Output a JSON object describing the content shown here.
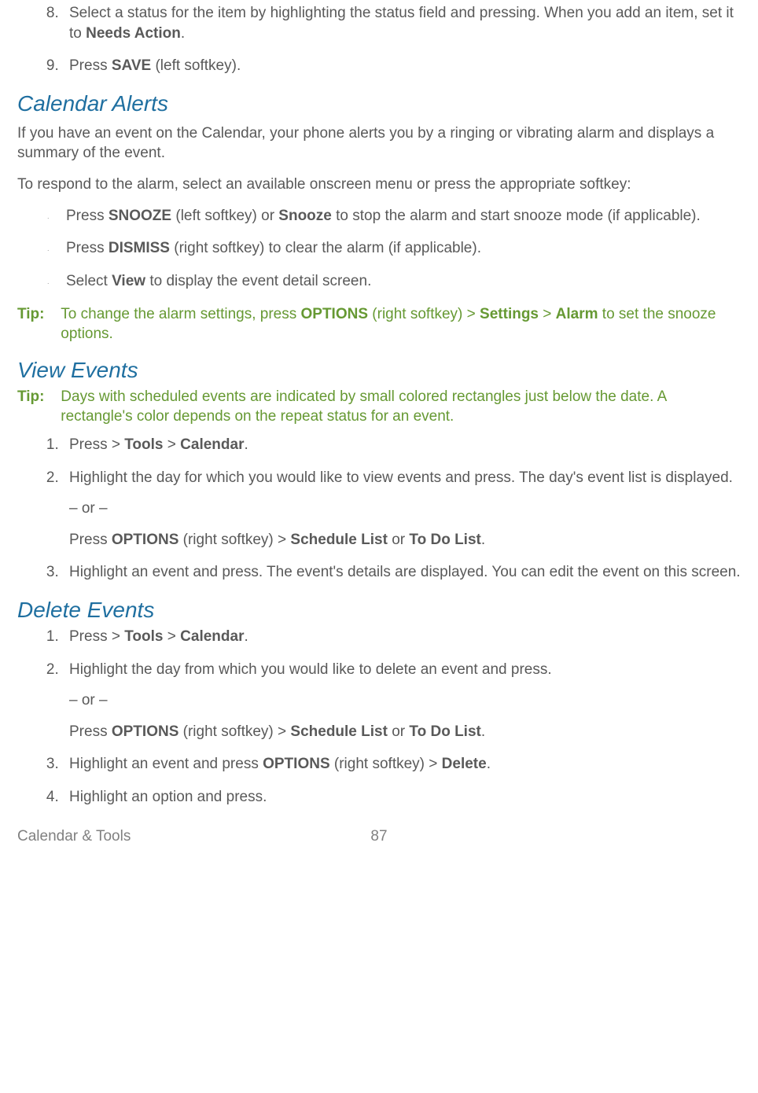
{
  "top_list": {
    "item8": {
      "pre": "Select a status for the item by highlighting the status field and pressing. When you add an item, set it to ",
      "bold": "Needs Action",
      "post": "."
    },
    "item9": {
      "pre": "Press ",
      "bold": "SAVE",
      "post": " (left softkey)."
    }
  },
  "calendar_alerts": {
    "heading": "Calendar Alerts",
    "intro": "If you have an event on the Calendar, your phone alerts you by a ringing or vibrating alarm and displays a summary of the event.",
    "respond": "To respond to the alarm, select an available onscreen menu or press the appropriate softkey:",
    "b1": {
      "p1": "Press ",
      "b1": "SNOOZE",
      "p2": " (left softkey) or ",
      "b2": "Snooze",
      "p3": " to stop the alarm and start snooze mode (if applicable)."
    },
    "b2": {
      "p1": "Press ",
      "b1": "DISMISS",
      "p2": " (right softkey) to clear the alarm (if applicable)."
    },
    "b3": {
      "p1": "Select ",
      "b1": "View",
      "p2": " to display the event detail screen."
    },
    "tip": {
      "label": "Tip:",
      "t1": "To change the alarm settings, press ",
      "b1": "OPTIONS",
      "t2": " (right softkey) > ",
      "b2": "Settings",
      "t3": " > ",
      "b3": "Alarm",
      "t4": " to set the snooze options."
    }
  },
  "view_events": {
    "heading": "View Events",
    "tip": {
      "label": "Tip:",
      "text": "Days with scheduled events are indicated by small colored rectangles just below the date. A rectangle's color depends on the repeat status for an event."
    },
    "s1": {
      "p1": "Press  > ",
      "b1": "Tools",
      "p2": " > ",
      "b2": "Calendar",
      "p3": "."
    },
    "s2": {
      "line1": "Highlight the day for which you would like to view events and press. The day's event list is displayed.",
      "or": "– or –",
      "line2a": "Press ",
      "b1": "OPTIONS",
      "line2b": " (right softkey) > ",
      "b2": "Schedule List",
      "line2c": " or ",
      "b3": "To Do List",
      "line2d": "."
    },
    "s3": "Highlight an event and press. The event's details are displayed. You can edit the event on this screen."
  },
  "delete_events": {
    "heading": "Delete Events",
    "s1": {
      "p1": "Press  > ",
      "b1": "Tools",
      "p2": " > ",
      "b2": "Calendar",
      "p3": "."
    },
    "s2": {
      "line1": "Highlight the day from which you would like to delete an event and press.",
      "or": "– or –",
      "l2a": "Press ",
      "b1": "OPTIONS",
      "l2b": " (right softkey) > ",
      "b2": "Schedule List",
      "l2c": " or ",
      "b3": "To Do List",
      "l2d": "."
    },
    "s3": {
      "a": "Highlight an event and press ",
      "b1": "OPTIONS",
      "b": " (right softkey) > ",
      "b2": "Delete",
      "c": "."
    },
    "s4": "Highlight an option and press."
  },
  "footer": {
    "section": "Calendar & Tools",
    "page": "87"
  }
}
